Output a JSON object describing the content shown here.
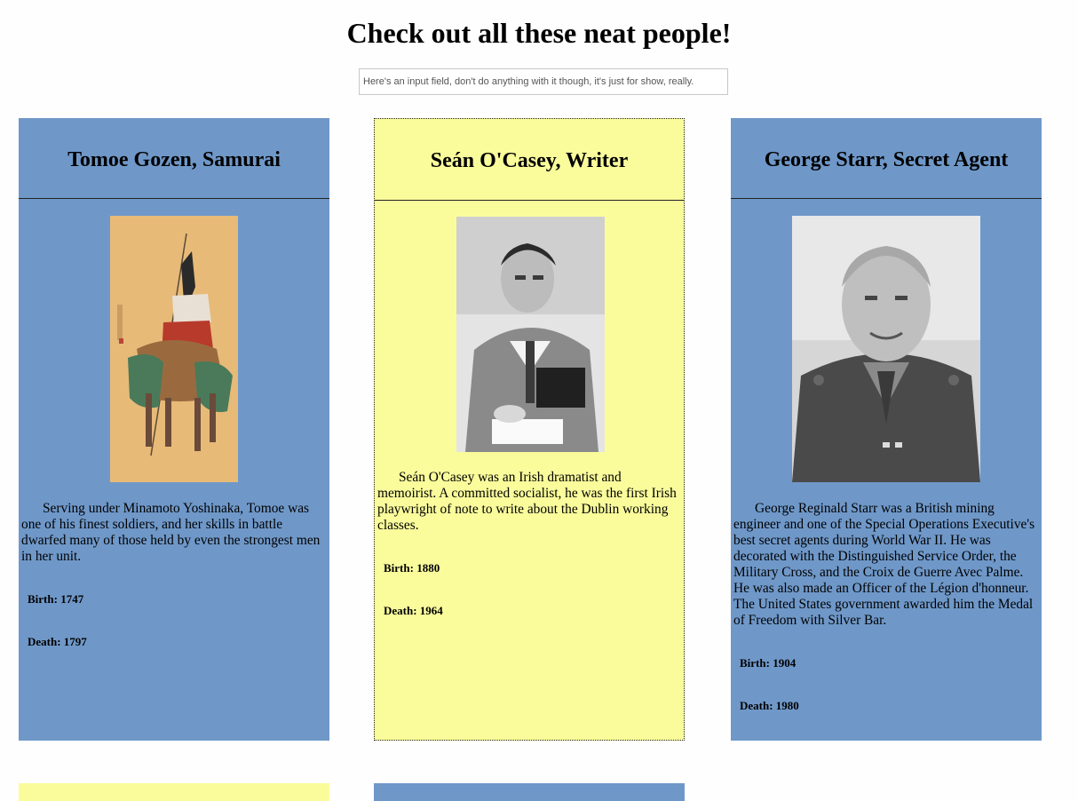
{
  "header": {
    "title": "Check out all these neat people!"
  },
  "search": {
    "placeholder": "Here's an input field, don't do anything with it though, it's just for show, really."
  },
  "cards": [
    {
      "title": "Tomoe Gozen, Samurai",
      "bio": "Serving under Minamoto Yoshinaka, Tomoe was one of his finest soldiers, and her skills in battle dwarfed many of those held by even the strongest men in her unit.",
      "birth": "Birth: 1747",
      "death": "Death: 1797",
      "color": "#6f98c9"
    },
    {
      "title": "Seán O'Casey, Writer",
      "bio": "Seán O'Casey was an Irish dramatist and memoirist. A committed socialist, he was the first Irish playwright of note to write about the Dublin working classes.",
      "birth": "Birth: 1880",
      "death": "Death: 1964",
      "color": "#fafc9b"
    },
    {
      "title": "George Starr, Secret Agent",
      "bio": "George Reginald Starr was a British mining engineer and one of the Special Operations Executive's best secret agents during World War II. He was decorated with the Distinguished Service Order, the Military Cross, and the Croix de Guerre Avec Palme. He was also made an Officer of the Légion d'honneur. The United States government awarded him the Medal of Freedom with Silver Bar.",
      "birth": "Birth: 1904",
      "death": "Death: 1980",
      "color": "#6f98c9"
    }
  ]
}
